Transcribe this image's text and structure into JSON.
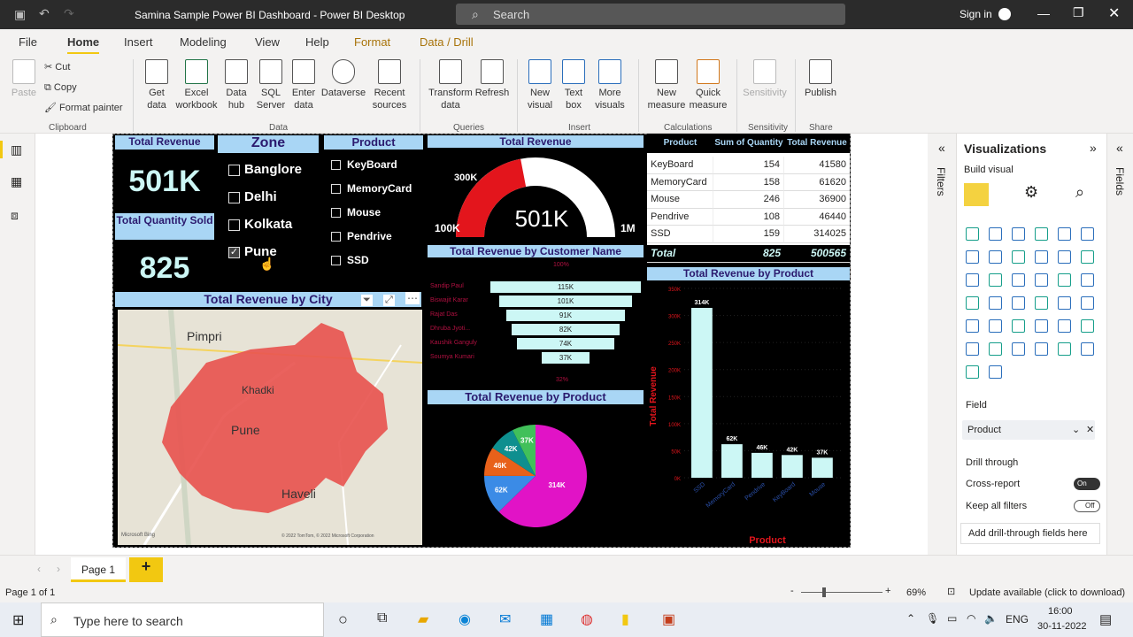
{
  "window": {
    "title": "Samina Sample Power BI Dashboard - Power BI Desktop",
    "search_placeholder": "Search",
    "sign_in": "Sign in"
  },
  "menu": [
    "File",
    "Home",
    "Insert",
    "Modeling",
    "View",
    "Help",
    "Format",
    "Data / Drill"
  ],
  "menu_active": "Home",
  "ribbon": {
    "clipboard": {
      "paste": "Paste",
      "cut": "Cut",
      "copy": "Copy",
      "format_painter": "Format painter",
      "group": "Clipboard"
    },
    "data": {
      "get_data": "Get data",
      "excel": "Excel workbook",
      "data_hub": "Data hub",
      "sql": "SQL Server",
      "enter": "Enter data",
      "dataverse": "Dataverse",
      "recent": "Recent sources",
      "group": "Data"
    },
    "queries": {
      "transform": "Transform data",
      "refresh": "Refresh",
      "group": "Queries"
    },
    "insert": {
      "new_visual": "New visual",
      "text_box": "Text box",
      "more_visuals": "More visuals",
      "group": "Insert"
    },
    "calculations": {
      "new_measure": "New measure",
      "quick_measure": "Quick measure",
      "group": "Calculations"
    },
    "sensitivity": {
      "label": "Sensitivity",
      "group": "Sensitivity"
    },
    "share": {
      "publish": "Publish",
      "group": "Share"
    }
  },
  "report": {
    "kpi_revenue": {
      "title": "Total Revenue",
      "value": "501K"
    },
    "kpi_quantity": {
      "title": "Total Quantity Sold",
      "value": "825"
    },
    "zone_slicer": {
      "title": "Zone",
      "items": [
        {
          "label": "Banglore",
          "checked": false
        },
        {
          "label": "Delhi",
          "checked": false
        },
        {
          "label": "Kolkata",
          "checked": false
        },
        {
          "label": "Pune",
          "checked": true
        }
      ]
    },
    "product_slicer": {
      "title": "Product",
      "items": [
        {
          "label": "KeyBoard",
          "checked": false
        },
        {
          "label": "MemoryCard",
          "checked": false
        },
        {
          "label": "Mouse",
          "checked": false
        },
        {
          "label": "Pendrive",
          "checked": false
        },
        {
          "label": "SSD",
          "checked": false
        }
      ]
    },
    "gauge": {
      "title": "Total Revenue",
      "value_label": "501K",
      "min": "100K",
      "max": "1M",
      "target": "300K",
      "fraction": 0.44
    },
    "table": {
      "headers": [
        "Product",
        "Sum of Quantity",
        "Total Revenue"
      ],
      "rows": [
        [
          "KeyBoard",
          "154",
          "41580"
        ],
        [
          "MemoryCard",
          "158",
          "61620"
        ],
        [
          "Mouse",
          "246",
          "36900"
        ],
        [
          "Pendrive",
          "108",
          "46440"
        ],
        [
          "SSD",
          "159",
          "314025"
        ]
      ],
      "total": [
        "Total",
        "825",
        "500565"
      ]
    },
    "funnel": {
      "title": "Total Revenue by Customer Name",
      "top_pct": "100%",
      "bottom_pct": "32%",
      "rows": [
        {
          "name": "Sandip Paul",
          "label": "115K",
          "value": 115
        },
        {
          "name": "Biswajit Karar",
          "label": "101K",
          "value": 101
        },
        {
          "name": "Rajat Das",
          "label": "91K",
          "value": 91
        },
        {
          "name": "Dhruba Jyoti...",
          "label": "82K",
          "value": 82
        },
        {
          "name": "Kaushik Ganguly",
          "label": "74K",
          "value": 74
        },
        {
          "name": "Soumya Kumari",
          "label": "37K",
          "value": 37
        }
      ]
    },
    "map": {
      "title": "Total Revenue by City",
      "places": [
        "Pimpri",
        "Khadki",
        "Pune",
        "Haveli"
      ],
      "credit": "© 2022 TomTom, © 2022 Microsoft Corporation",
      "logo": "Microsoft Bing"
    },
    "pie": {
      "title": "Total Revenue by Product",
      "slices": [
        {
          "label": "314K",
          "value": 314,
          "color": "#e113c6"
        },
        {
          "label": "62K",
          "value": 62,
          "color": "#3b8be6"
        },
        {
          "label": "46K",
          "value": 46,
          "color": "#e8611a"
        },
        {
          "label": "42K",
          "value": 42,
          "color": "#0e8f8f"
        },
        {
          "label": "37K",
          "value": 37,
          "color": "#41c05a"
        }
      ]
    },
    "bar": {
      "title": "Total Revenue by Product",
      "ylabel": "Total Revenue",
      "xlabel": "Product"
    }
  },
  "chart_data": {
    "type": "bar",
    "title": "Total Revenue by Product",
    "categories": [
      "SSD",
      "MemoryCard",
      "Pendrive",
      "KeyBoard",
      "Mouse"
    ],
    "values": [
      314,
      62,
      46,
      42,
      37
    ],
    "value_labels": [
      "314K",
      "62K",
      "46K",
      "42K",
      "37K"
    ],
    "yticks": [
      "0K",
      "50K",
      "100K",
      "150K",
      "200K",
      "250K",
      "300K",
      "350K"
    ],
    "ylim": [
      0,
      350
    ],
    "xlabel": "Product",
    "ylabel": "Total Revenue",
    "bar_color": "#ccf7f5"
  },
  "viz_pane": {
    "title": "Visualizations",
    "build": "Build visual",
    "filters": "Filters",
    "fields": "Fields",
    "field_label": "Field",
    "field_value": "Product",
    "drill": "Drill through",
    "cross_report": "Cross-report",
    "cross_state": "On",
    "keep_filters": "Keep all filters",
    "keep_state": "Off",
    "add_drill": "Add drill-through fields here"
  },
  "pages": {
    "tab": "Page 1",
    "status": "Page 1 of 1",
    "zoom": "69%",
    "update": "Update available (click to download)"
  },
  "taskbar": {
    "search": "Type here to search",
    "lang": "ENG",
    "time": "16:00",
    "date": "30-11-2022"
  }
}
